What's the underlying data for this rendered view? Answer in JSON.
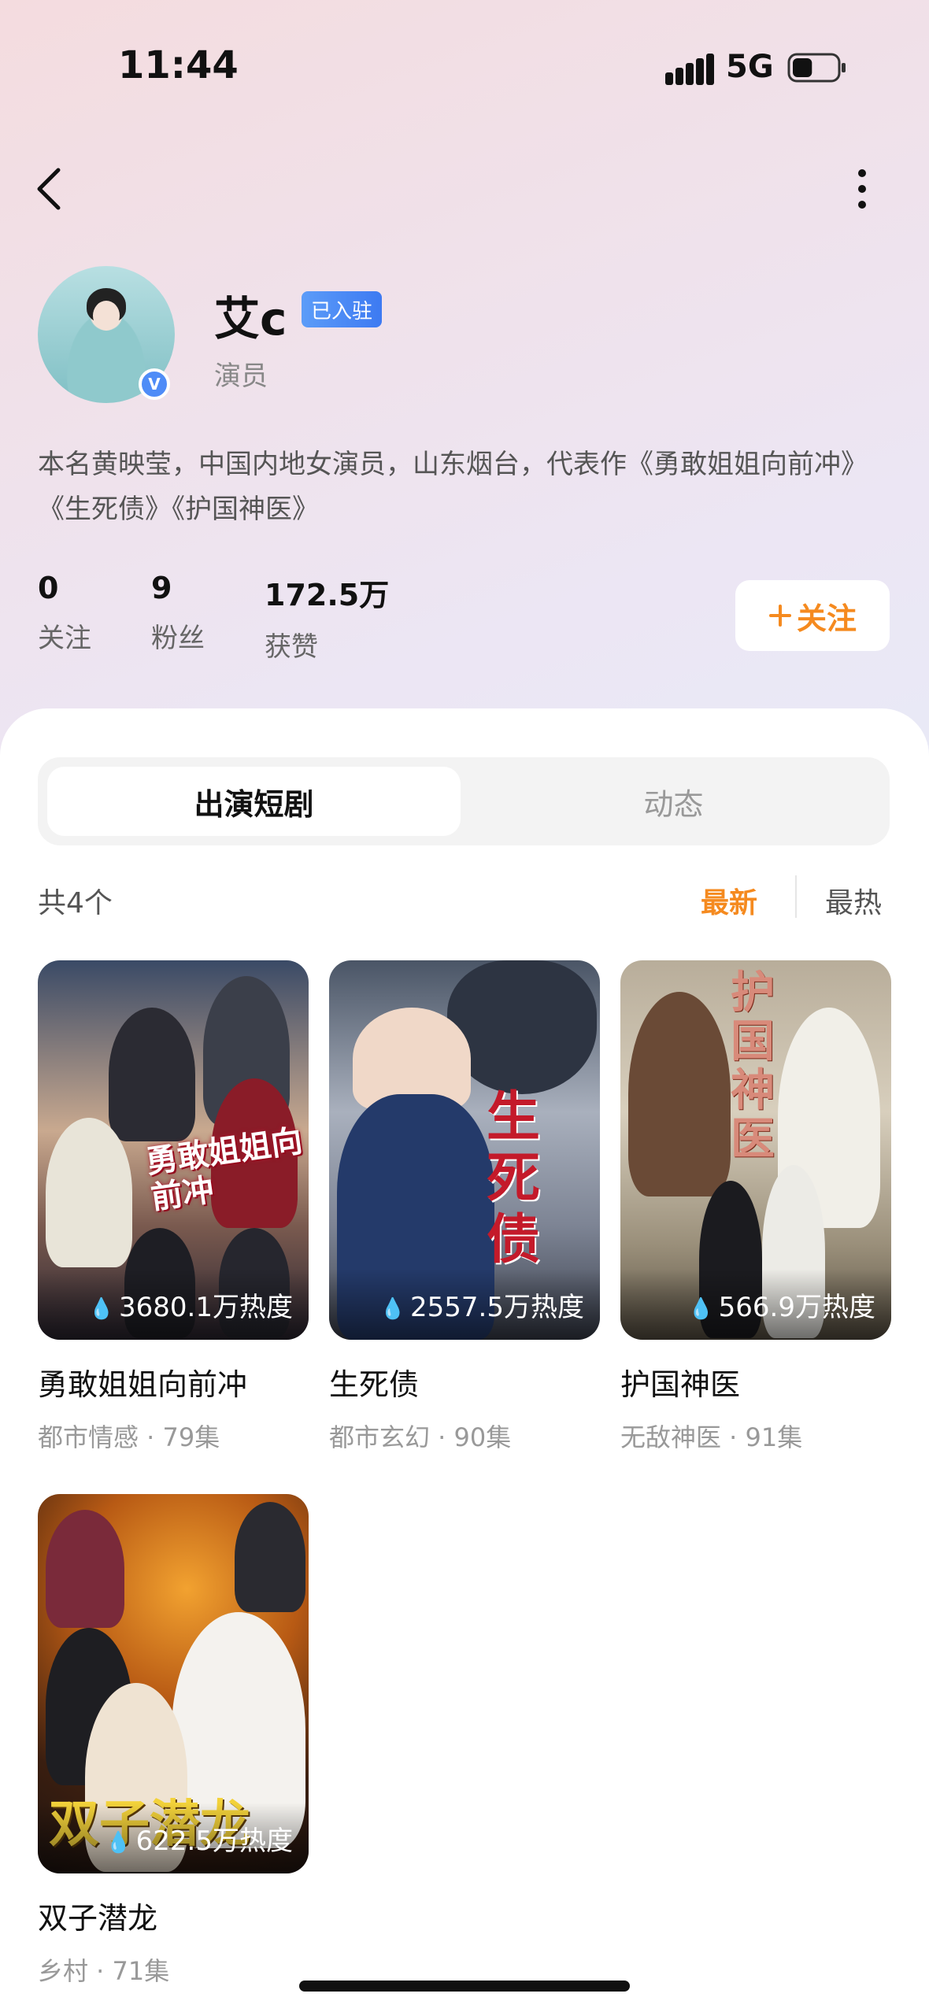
{
  "status_bar": {
    "time": "11:44",
    "network": "5G",
    "battery_level": 0.45
  },
  "profile": {
    "name": "艾c",
    "badge": "已入驻",
    "role": "演员",
    "verified_mark": "V",
    "bio": "本名黄映莹，中国内地女演员，山东烟台，代表作《勇敢姐姐向前冲》《生死债》《护国神医》",
    "stats": [
      {
        "value": "0",
        "label": "关注"
      },
      {
        "value": "9",
        "label": "粉丝"
      },
      {
        "value": "172.5万",
        "label": "获赞"
      }
    ],
    "follow_label": "关注",
    "follow_icon": "plus-icon"
  },
  "tabs": [
    {
      "label": "出演短剧",
      "active": true
    },
    {
      "label": "动态",
      "active": false
    }
  ],
  "list": {
    "count_label": "共4个",
    "sort_options": [
      {
        "label": "最新",
        "active": true
      },
      {
        "label": "最热",
        "active": false
      }
    ]
  },
  "dramas": [
    {
      "title": "勇敢姐姐向前冲",
      "poster_text": "勇敢姐姐向前冲",
      "heat": "3680.1万热度",
      "meta": "都市情感 · 79集"
    },
    {
      "title": "生死债",
      "poster_text": "生死债",
      "heat": "2557.5万热度",
      "meta": "都市玄幻 · 90集"
    },
    {
      "title": "护国神医",
      "poster_text": "护国神医",
      "heat": "566.9万热度",
      "meta": "无敌神医 · 91集"
    },
    {
      "title": "双子潜龙",
      "poster_text": "双子潜龙",
      "heat": "622.5万热度",
      "meta": "乡村 · 71集"
    }
  ],
  "colors": {
    "accent": "#f58a1f",
    "badge_blue": "#4f8cf7"
  }
}
